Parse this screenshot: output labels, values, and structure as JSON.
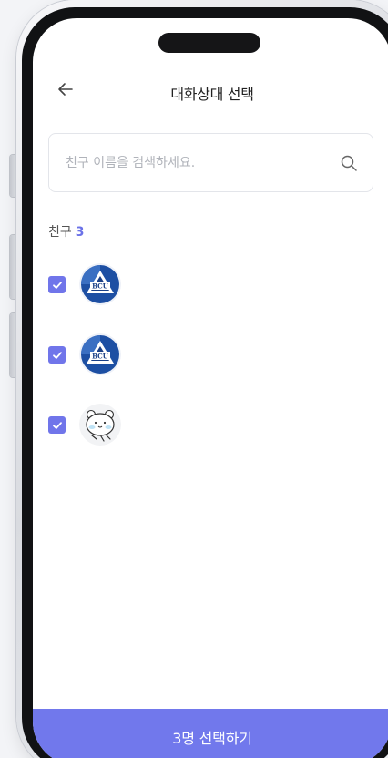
{
  "header": {
    "title": "대화상대 선택"
  },
  "search": {
    "placeholder": "친구 이름을 검색하세요."
  },
  "friends": {
    "heading": "친구",
    "count": "3",
    "items": [
      {
        "avatar": "bcu-logo",
        "checked": true
      },
      {
        "avatar": "bcu-logo",
        "checked": true
      },
      {
        "avatar": "bear-sticker",
        "checked": true
      }
    ]
  },
  "cta": {
    "label": "3명 선택하기"
  },
  "colors": {
    "accent": "#7178ec",
    "checkbox": "#7075ea",
    "background": "#f3f4f7"
  }
}
